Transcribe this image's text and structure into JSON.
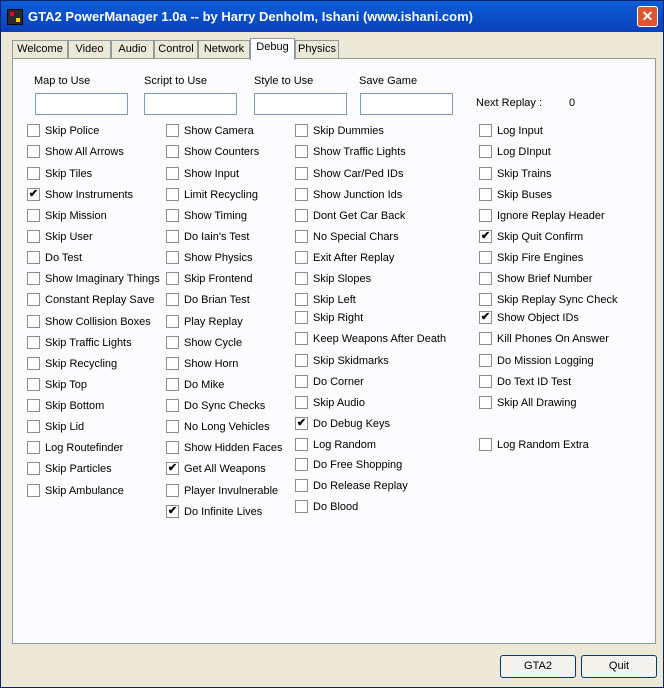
{
  "window": {
    "title": "GTA2 PowerManager 1.0a -- by Harry Denholm, Ishani (www.ishani.com)",
    "close_glyph": "✕"
  },
  "tabs": [
    "Welcome",
    "Video",
    "Audio",
    "Control",
    "Network",
    "Debug",
    "Physics"
  ],
  "active_tab": "Debug",
  "fields": {
    "map": {
      "label": "Map to Use",
      "value": ""
    },
    "script": {
      "label": "Script to Use",
      "value": ""
    },
    "style": {
      "label": "Style to Use",
      "value": ""
    },
    "save": {
      "label": "Save Game",
      "value": ""
    }
  },
  "next_replay": {
    "label": "Next Replay :",
    "value": "0"
  },
  "columns": [
    [
      [
        "Skip Police",
        false
      ],
      [
        "Show All Arrows",
        false
      ],
      [
        "Skip Tiles",
        false
      ],
      [
        "Show Instruments",
        true
      ],
      [
        "Skip Mission",
        false
      ],
      [
        "Skip User",
        false
      ],
      [
        "Do Test",
        false
      ],
      [
        "Show Imaginary Things",
        false
      ],
      [
        "Constant Replay Save",
        false
      ],
      [
        "Show Collision Boxes",
        false
      ],
      [
        "Skip Traffic Lights",
        false
      ],
      [
        "Skip Recycling",
        false
      ],
      [
        "Skip Top",
        false
      ],
      [
        "Skip Bottom",
        false
      ],
      [
        "Skip Lid",
        false
      ],
      [
        "Log Routefinder",
        false
      ],
      [
        "Skip Particles",
        false
      ],
      [
        "Skip Ambulance",
        false
      ]
    ],
    [
      [
        "Show Camera",
        false
      ],
      [
        "Show Counters",
        false
      ],
      [
        "Show Input",
        false
      ],
      [
        "Limit Recycling",
        false
      ],
      [
        "Show Timing",
        false
      ],
      [
        "Do Iain's Test",
        false
      ],
      [
        "Show Physics",
        false
      ],
      [
        "Skip Frontend",
        false
      ],
      [
        "Do Brian Test",
        false
      ],
      [
        "Play Replay",
        false
      ],
      [
        "Show Cycle",
        false
      ],
      [
        "Show Horn",
        false
      ],
      [
        "Do Mike",
        false
      ],
      [
        "Do Sync Checks",
        false
      ],
      [
        "No Long Vehicles",
        false
      ],
      [
        "Show Hidden Faces",
        false
      ],
      [
        "Get All Weapons",
        true
      ],
      [
        "Player Invulnerable",
        false
      ],
      [
        "Do Infinite Lives",
        true
      ]
    ],
    [
      [
        "Skip Dummies",
        false
      ],
      [
        "Show Traffic Lights",
        false
      ],
      [
        "Show Car/Ped IDs",
        false
      ],
      [
        "Show Junction Ids",
        false
      ],
      [
        "Dont Get Car Back",
        false
      ],
      [
        "No Special Chars",
        false
      ],
      [
        "Exit After Replay",
        false
      ],
      [
        "Skip Slopes",
        false
      ],
      [
        "Skip Left",
        false
      ],
      [
        "Skip Right",
        false
      ],
      [
        "Keep Weapons After Death",
        false
      ],
      [
        "Skip Skidmarks",
        false
      ],
      [
        "Do Corner",
        false
      ],
      [
        "Skip Audio",
        false
      ],
      [
        "Do Debug Keys",
        true
      ],
      [
        "Log Random",
        false
      ],
      [
        "Do Free Shopping",
        false
      ],
      [
        "Do Release Replay",
        false
      ],
      [
        "Do Blood",
        false
      ]
    ],
    [
      [
        "Log Input",
        false
      ],
      [
        "Log DInput",
        false
      ],
      [
        "Skip Trains",
        false
      ],
      [
        "Skip Buses",
        false
      ],
      [
        "Ignore Replay Header",
        false
      ],
      [
        "Skip Quit Confirm",
        true
      ],
      [
        "Skip Fire Engines",
        false
      ],
      [
        "Show Brief Number",
        false
      ],
      [
        "Skip Replay Sync Check",
        false
      ],
      [
        "Show Object IDs",
        true
      ],
      [
        "Kill Phones On Answer",
        false
      ],
      [
        "Do Mission Logging",
        false
      ],
      [
        "Do Text ID Test",
        false
      ],
      [
        "Skip All Drawing",
        false
      ],
      [
        "Log Random Extra",
        false
      ]
    ]
  ],
  "check_glyph": "✔",
  "buttons": {
    "gta2": "GTA2",
    "quit": "Quit"
  }
}
